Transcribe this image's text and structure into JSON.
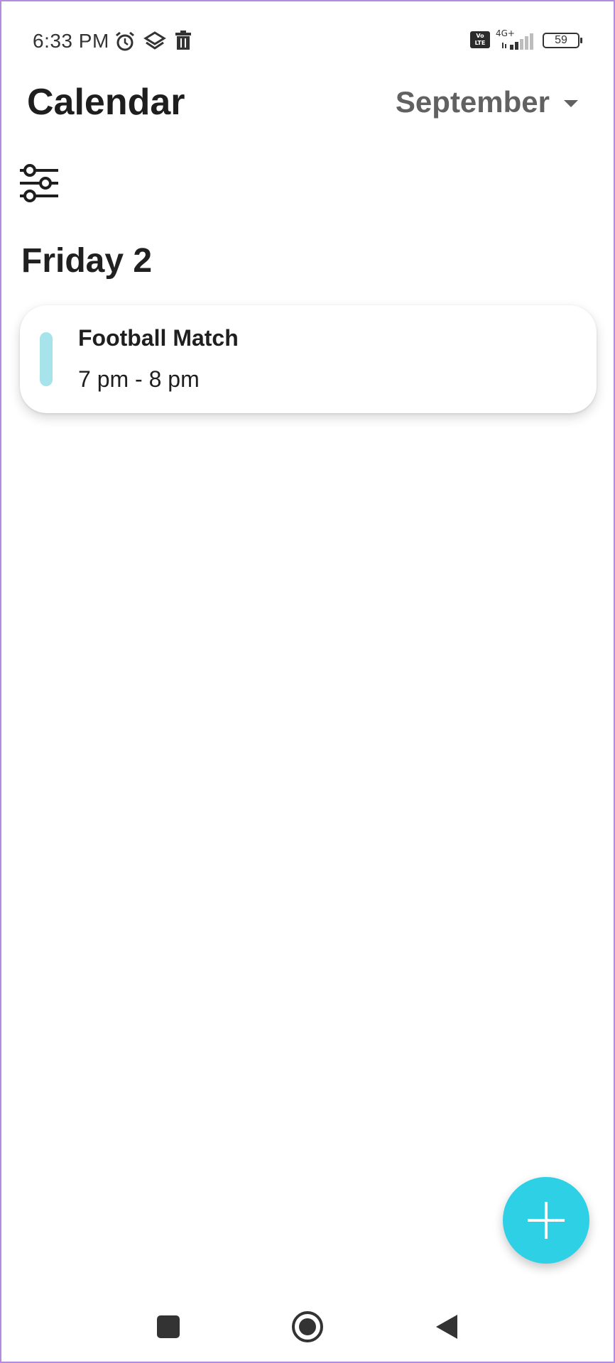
{
  "status_bar": {
    "time": "6:33 PM",
    "icons": [
      "alarm-icon",
      "stack-icon",
      "trash-icon"
    ],
    "volte": "Vo LTE",
    "network": "4G+",
    "battery": "59"
  },
  "header": {
    "title": "Calendar",
    "month": "September"
  },
  "filter": {
    "icon": "sliders-icon"
  },
  "day": {
    "heading": "Friday 2"
  },
  "events": [
    {
      "title": "Football Match",
      "time": "7 pm - 8 pm",
      "color": "#a6e3ea"
    }
  ],
  "fab": {
    "icon": "plus-icon",
    "color": "#2ed0e6"
  },
  "nav": {
    "recent_icon": "square-icon",
    "home_icon": "circle-icon",
    "back_icon": "triangle-back-icon"
  }
}
